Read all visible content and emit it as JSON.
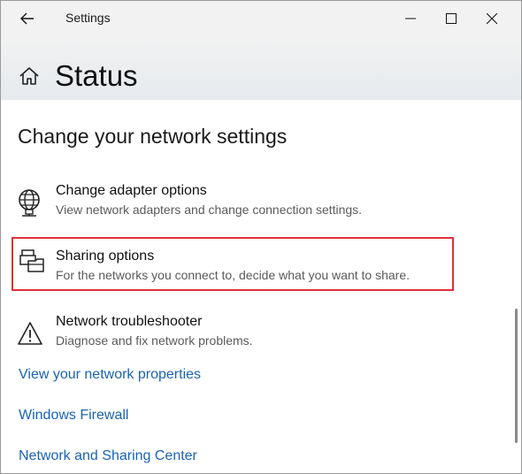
{
  "window": {
    "title": "Settings"
  },
  "header": {
    "title": "Status"
  },
  "content": {
    "heading": "Change your network settings",
    "options": [
      {
        "title": "Change adapter options",
        "description": "View network adapters and change connection settings.",
        "icon": "network-adapter-icon"
      },
      {
        "title": "Sharing options",
        "description": "For the networks you connect to, decide what you want to share.",
        "icon": "sharing-icon",
        "highlighted": true
      },
      {
        "title": "Network troubleshooter",
        "description": "Diagnose and fix network problems.",
        "icon": "warning-icon"
      }
    ],
    "links": [
      "View your network properties",
      "Windows Firewall",
      "Network and Sharing Center"
    ]
  },
  "colors": {
    "link": "#1a63b5",
    "highlight_border": "#e0303a"
  }
}
